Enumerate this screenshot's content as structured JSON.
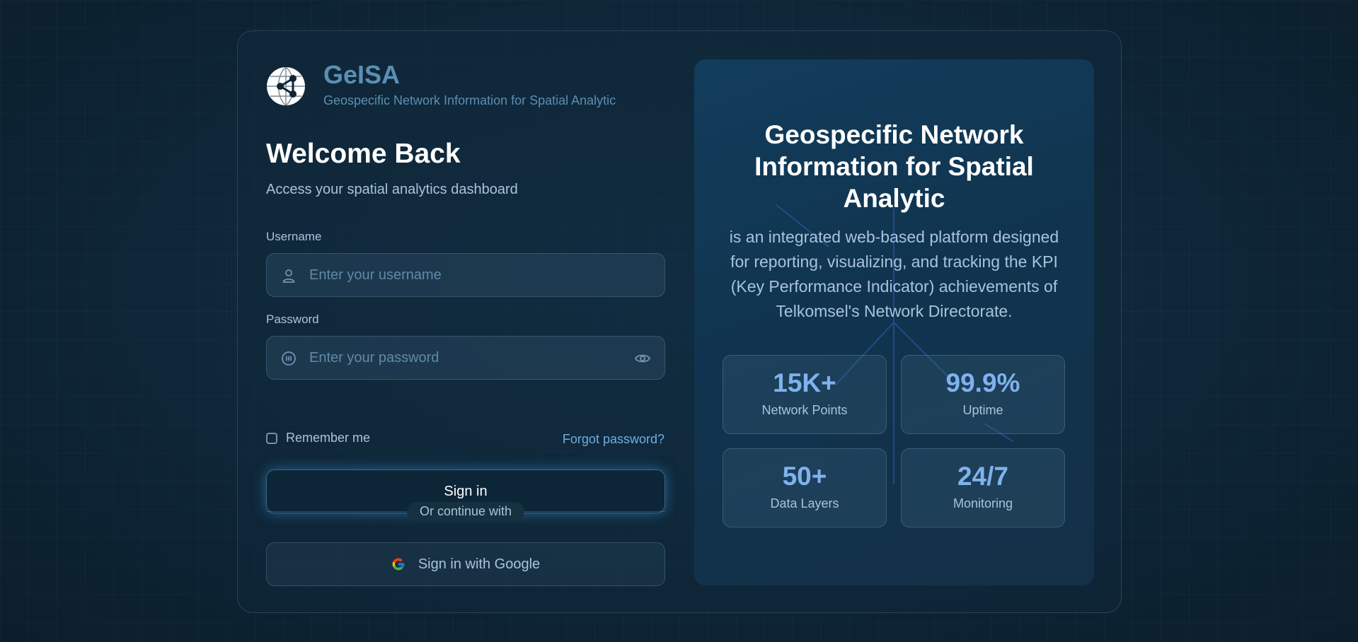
{
  "brand": {
    "name": "GeISA",
    "tagline": "Geospecific Network Information for Spatial Analytic"
  },
  "login": {
    "title": "Welcome Back",
    "subtitle": "Access your spatial analytics dashboard",
    "username": {
      "label": "Username",
      "placeholder": "Enter your username",
      "value": ""
    },
    "password": {
      "label": "Password",
      "placeholder": "Enter your password",
      "value": ""
    },
    "remember_label": "Remember me",
    "remember_checked": false,
    "forgot_label": "Forgot password?",
    "signin_label": "Sign in",
    "divider_label": "Or continue with",
    "google_label": "Sign in with Google"
  },
  "info": {
    "title": "Geospecific Network Information for Spatial Analytic",
    "description": "is an integrated web-based platform designed for reporting, visualizing, and tracking the KPI (Key Performance Indicator) achievements of Telkomsel's Network Directorate.",
    "stats": [
      {
        "value": "15K+",
        "label": "Network Points"
      },
      {
        "value": "99.9%",
        "label": "Uptime"
      },
      {
        "value": "50+",
        "label": "Data Layers"
      },
      {
        "value": "24/7",
        "label": "Monitoring"
      }
    ]
  },
  "icons": {
    "logo": "globe-network-icon",
    "username": "user-icon",
    "password": "password-icon",
    "toggle": "eye-icon",
    "google": "google-icon"
  },
  "colors": {
    "accent": "#5b8fb3",
    "link": "#6faee0",
    "stat_value": "#7fb2ee",
    "muted_text": "#a9c3dc"
  }
}
